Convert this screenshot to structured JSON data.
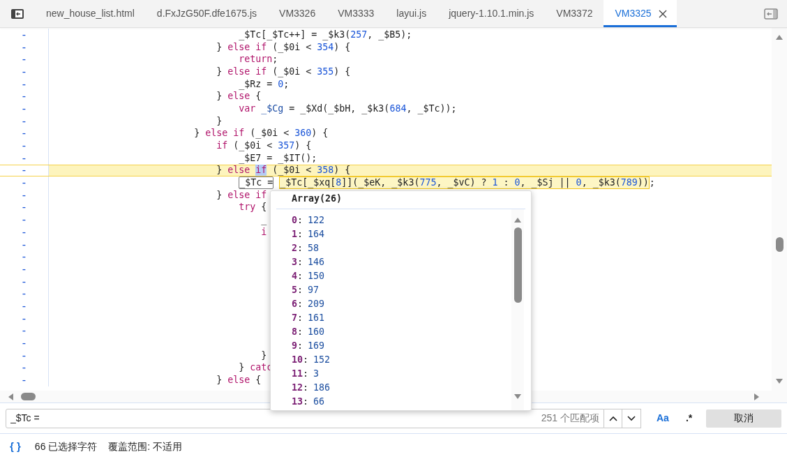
{
  "tabs": [
    {
      "label": "new_house_list.html",
      "selected": false
    },
    {
      "label": "d.FxJzG50F.dfe1675.js",
      "selected": false
    },
    {
      "label": "VM3326",
      "selected": false
    },
    {
      "label": "VM3333",
      "selected": false
    },
    {
      "label": "layui.js",
      "selected": false
    },
    {
      "label": "jquery-1.10.1.min.js",
      "selected": false
    },
    {
      "label": "VM3372",
      "selected": false
    },
    {
      "label": "VM3325",
      "selected": true
    }
  ],
  "code_lines": [
    {
      "marker": "-",
      "highlighted": false,
      "tokens": [
        {
          "text": "                                _$Tc[_$Tc++] = _$k3(",
          "kind": "plain"
        },
        {
          "text": "257",
          "kind": "number"
        },
        {
          "text": ", _$B5);",
          "kind": "plain"
        }
      ]
    },
    {
      "marker": "-",
      "highlighted": false,
      "tokens": [
        {
          "text": "                            } ",
          "kind": "plain"
        },
        {
          "text": "else if",
          "kind": "keyword"
        },
        {
          "text": " (_$0i < ",
          "kind": "plain"
        },
        {
          "text": "354",
          "kind": "number"
        },
        {
          "text": ") {",
          "kind": "plain"
        }
      ]
    },
    {
      "marker": "-",
      "highlighted": false,
      "tokens": [
        {
          "text": "                                return",
          "kind": "keyword"
        },
        {
          "text": ";",
          "kind": "plain"
        }
      ]
    },
    {
      "marker": "-",
      "highlighted": false,
      "tokens": [
        {
          "text": "                            } ",
          "kind": "plain"
        },
        {
          "text": "else if",
          "kind": "keyword"
        },
        {
          "text": " (_$0i < ",
          "kind": "plain"
        },
        {
          "text": "355",
          "kind": "number"
        },
        {
          "text": ") {",
          "kind": "plain"
        }
      ]
    },
    {
      "marker": "-",
      "highlighted": false,
      "tokens": [
        {
          "text": "                                _$Rz = ",
          "kind": "plain"
        },
        {
          "text": "0",
          "kind": "number"
        },
        {
          "text": ";",
          "kind": "plain"
        }
      ]
    },
    {
      "marker": "-",
      "highlighted": false,
      "tokens": [
        {
          "text": "                            } ",
          "kind": "plain"
        },
        {
          "text": "else",
          "kind": "keyword"
        },
        {
          "text": " {",
          "kind": "plain"
        }
      ]
    },
    {
      "marker": "-",
      "highlighted": false,
      "tokens": [
        {
          "text": "                                var",
          "kind": "keyword"
        },
        {
          "text": " _$Cg",
          "kind": "definition"
        },
        {
          "text": " = _$Xd(_$bH, _$k3(",
          "kind": "plain"
        },
        {
          "text": "684",
          "kind": "number"
        },
        {
          "text": ", _$Tc));",
          "kind": "plain"
        }
      ]
    },
    {
      "marker": "-",
      "highlighted": false,
      "tokens": [
        {
          "text": "                            }",
          "kind": "plain"
        }
      ]
    },
    {
      "marker": "-",
      "highlighted": false,
      "tokens": [
        {
          "text": "                        } ",
          "kind": "plain"
        },
        {
          "text": "else if",
          "kind": "keyword"
        },
        {
          "text": " (_$0i < ",
          "kind": "plain"
        },
        {
          "text": "360",
          "kind": "number"
        },
        {
          "text": ") {",
          "kind": "plain"
        }
      ]
    },
    {
      "marker": "-",
      "highlighted": false,
      "tokens": [
        {
          "text": "                            if",
          "kind": "keyword"
        },
        {
          "text": " (_$0i < ",
          "kind": "plain"
        },
        {
          "text": "357",
          "kind": "number"
        },
        {
          "text": ") {",
          "kind": "plain"
        }
      ]
    },
    {
      "marker": "-",
      "highlighted": false,
      "tokens": [
        {
          "text": "                                _$E7 = _$IT();",
          "kind": "plain"
        }
      ]
    },
    {
      "marker": "-",
      "highlighted": true,
      "tokens": [
        {
          "text": "                            } ",
          "kind": "plain",
          "selected": false
        },
        {
          "text": "else ",
          "kind": "keyword",
          "selected": false
        },
        {
          "text": "if",
          "kind": "keyword",
          "selected": true
        },
        {
          "text": " (_$0i < ",
          "kind": "plain",
          "selected": false
        },
        {
          "text": "358",
          "kind": "number",
          "selected": false
        },
        {
          "text": ") {",
          "kind": "plain",
          "selected": false
        }
      ]
    },
    {
      "marker": "-",
      "highlighted": false,
      "search_match": "                                _$Tc =",
      "hover_expression": [
        {
          "text": "_$Tc[_$xq[",
          "kind": "plain"
        },
        {
          "text": "8",
          "kind": "number"
        },
        {
          "text": "]](_$eK, _$k3(",
          "kind": "plain"
        },
        {
          "text": "775",
          "kind": "number"
        },
        {
          "text": ", _$vC) ? ",
          "kind": "plain"
        },
        {
          "text": "1",
          "kind": "number"
        },
        {
          "text": " : ",
          "kind": "plain"
        },
        {
          "text": "0",
          "kind": "number"
        },
        {
          "text": ", _$Sj || ",
          "kind": "plain"
        },
        {
          "text": "0",
          "kind": "number"
        },
        {
          "text": ", _$k3(",
          "kind": "plain"
        },
        {
          "text": "789",
          "kind": "number"
        },
        {
          "text": "))",
          "kind": "plain"
        }
      ],
      "tokens": [
        {
          "text": ";",
          "kind": "plain"
        }
      ]
    },
    {
      "marker": "-",
      "highlighted": false,
      "tokens": [
        {
          "text": "                            } ",
          "kind": "plain"
        },
        {
          "text": "else if",
          "kind": "keyword"
        }
      ]
    },
    {
      "marker": "-",
      "highlighted": false,
      "tokens": [
        {
          "text": "                                try",
          "kind": "keyword"
        },
        {
          "text": " {",
          "kind": "plain"
        }
      ]
    },
    {
      "marker": "-",
      "highlighted": false,
      "tokens": [
        {
          "text": "                                    _",
          "kind": "plain"
        }
      ]
    },
    {
      "marker": "-",
      "highlighted": false,
      "tokens": [
        {
          "text": "                                    i",
          "kind": "keyword"
        }
      ]
    },
    {
      "marker": "-",
      "highlighted": false
    },
    {
      "marker": "-",
      "highlighted": false
    },
    {
      "marker": "-",
      "highlighted": false
    },
    {
      "marker": "-",
      "highlighted": false
    },
    {
      "marker": "-",
      "highlighted": false
    },
    {
      "marker": "-",
      "highlighted": false
    },
    {
      "marker": "-",
      "highlighted": false
    },
    {
      "marker": "-",
      "highlighted": false
    },
    {
      "marker": "-",
      "highlighted": false
    },
    {
      "marker": "-",
      "highlighted": false,
      "tokens": [
        {
          "text": "                                    }",
          "kind": "plain"
        }
      ]
    },
    {
      "marker": "-",
      "highlighted": false,
      "tokens": [
        {
          "text": "                                } ",
          "kind": "plain"
        },
        {
          "text": "catc",
          "kind": "keyword"
        }
      ]
    },
    {
      "marker": "-",
      "highlighted": false,
      "tokens": [
        {
          "text": "                            } ",
          "kind": "plain"
        },
        {
          "text": "else",
          "kind": "keyword"
        },
        {
          "text": " {",
          "kind": "plain"
        }
      ]
    }
  ],
  "popover": {
    "title": "Array(26)",
    "items": [
      {
        "key": "0",
        "separator": ":",
        "value": "122"
      },
      {
        "key": "1",
        "separator": ":",
        "value": "164"
      },
      {
        "key": "2",
        "separator": ":",
        "value": "58"
      },
      {
        "key": "3",
        "separator": ":",
        "value": "146"
      },
      {
        "key": "4",
        "separator": ":",
        "value": "150"
      },
      {
        "key": "5",
        "separator": ":",
        "value": "97"
      },
      {
        "key": "6",
        "separator": ":",
        "value": "209"
      },
      {
        "key": "7",
        "separator": ":",
        "value": "161"
      },
      {
        "key": "8",
        "separator": ":",
        "value": "160"
      },
      {
        "key": "9",
        "separator": ":",
        "value": "169"
      },
      {
        "key": "10",
        "separator": ":",
        "value": "152"
      },
      {
        "key": "11",
        "separator": ":",
        "value": "3"
      },
      {
        "key": "12",
        "separator": ":",
        "value": "186"
      },
      {
        "key": "13",
        "separator": ":",
        "value": "66"
      }
    ]
  },
  "search": {
    "value": "_$Tc =",
    "count": "251 个匹配项",
    "match_case": {
      "label": "Aa",
      "on": true
    },
    "regex": {
      "label": ".*",
      "on": false
    },
    "cancel": "取消"
  },
  "status_bar": {
    "format_icon": "{ }",
    "selection": "66 已选择字符",
    "coverage": "覆盖范围: 不适用"
  }
}
